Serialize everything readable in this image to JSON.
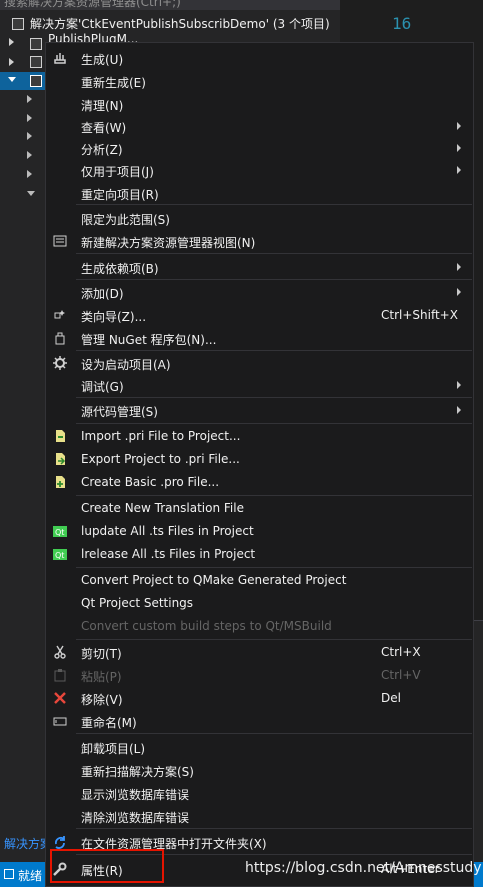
{
  "solution_explorer": {
    "search_placeholder": "搜索解决方案资源管理器(Ctrl+;)",
    "solution_label": "解决方案'CtkEventPublishSubscribDemo' (3 个项目)",
    "project1_label": "PublishPlugM...",
    "footer_label": "解决方案"
  },
  "editor": {
    "line_number": "16"
  },
  "status_bar": {
    "text": "就绪"
  },
  "watermark": "https://blog.csdn.net/Amnesstudy",
  "menu": {
    "build": "生成(U)",
    "rebuild": "重新生成(E)",
    "clean": "清理(N)",
    "view": "查看(W)",
    "analyze": "分析(Z)",
    "project_only": "仅用于项目(J)",
    "retarget": "重定向项目(R)",
    "scope_to_this": "限定为此范围(S)",
    "new_se_view": "新建解决方案资源管理器视图(N)",
    "build_dependencies": "生成依赖项(B)",
    "add": "添加(D)",
    "class_wizard": "类向导(Z)...",
    "class_wizard_shortcut": "Ctrl+Shift+X",
    "manage_nuget": "管理 NuGet 程序包(N)...",
    "set_startup": "设为启动项目(A)",
    "debug": "调试(G)",
    "source_control": "源代码管理(S)",
    "import_pri": "Import .pri File to Project...",
    "export_pri": "Export Project to .pri File...",
    "create_pro": "Create Basic .pro File...",
    "create_translation": "Create New Translation File",
    "lupdate": "lupdate All .ts Files in Project",
    "lrelease": "lrelease All .ts Files in Project",
    "convert_qmake": "Convert Project to QMake Generated Project",
    "qt_settings": "Qt Project Settings",
    "convert_custom": "Convert custom build steps to Qt/MSBuild",
    "cut": "剪切(T)",
    "cut_shortcut": "Ctrl+X",
    "paste": "粘贴(P)",
    "paste_shortcut": "Ctrl+V",
    "remove": "移除(V)",
    "remove_shortcut": "Del",
    "rename": "重命名(M)",
    "unload": "卸载项目(L)",
    "rescan": "重新扫描解决方案(S)",
    "show_db_errors": "显示浏览数据库错误",
    "clear_db_errors": "清除浏览数据库错误",
    "open_in_explorer": "在文件资源管理器中打开文件夹(X)",
    "properties": "属性(R)",
    "properties_shortcut": "Alt+Enter"
  },
  "colors": {
    "accent": "#007acc",
    "highlight_box": "#e51400",
    "menu_bg": "#1b1b1c",
    "disabled_text": "#656565"
  }
}
